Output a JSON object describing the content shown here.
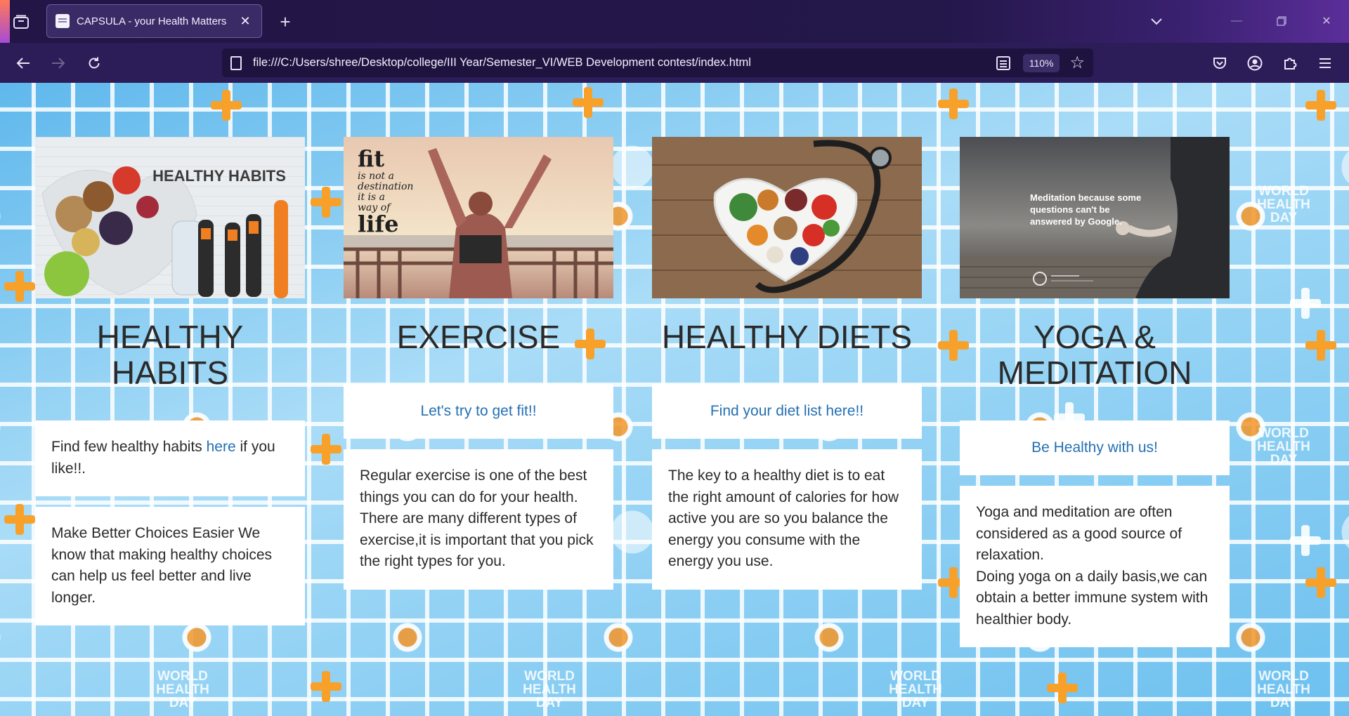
{
  "browser": {
    "tab_title": "CAPSULA - your Health Matters",
    "url": "file:///C:/Users/shree/Desktop/college/III Year/Semester_VI/WEB Development contest/index.html",
    "zoom": "110%"
  },
  "cards": [
    {
      "heading": "HEALTHY HABITS",
      "text1_pre": "Find few healthy habits ",
      "text1_link": "here",
      "text1_post": " if you like!!.",
      "text2": "Make Better Choices Easier We know that making healthy choices can help us feel better and live longer.",
      "image": {
        "caption": "HEALTHY HABITS"
      }
    },
    {
      "heading": "EXERCISE",
      "link": "Let's try to get fit!!",
      "text": "Regular exercise is one of the best things you can do for your health. There are many different types of exercise,it is important that you pick the right types for you.",
      "image": {
        "line1": "fit",
        "line2": "is not a",
        "line3": "destination",
        "line4": "it is a",
        "line5": "way of",
        "line6": "life"
      }
    },
    {
      "heading": "HEALTHY DIETS",
      "link": "Find your diet list here!!",
      "text": "The key to a healthy diet is to eat the right amount of calories for how active you are so you balance the energy you consume with the energy you use."
    },
    {
      "heading": "YOGA & MEDITATION",
      "link": "Be Healthy with us!",
      "text_line1": "Yoga and meditation are often considered as a good source of relaxation.",
      "text_line2": "Doing yoga on a daily basis,we can obtain a better immune system with healthier body.",
      "image": {
        "quote": "Meditation because some questions can't be answered by Google."
      }
    }
  ],
  "background": {
    "badge_line1": "WORLD",
    "badge_line2": "HEALTH",
    "badge_line3": "DAY"
  },
  "colors": {
    "link": "#2570b3",
    "accent_orange": "#f7a12b",
    "chrome": "#2c1c58"
  }
}
